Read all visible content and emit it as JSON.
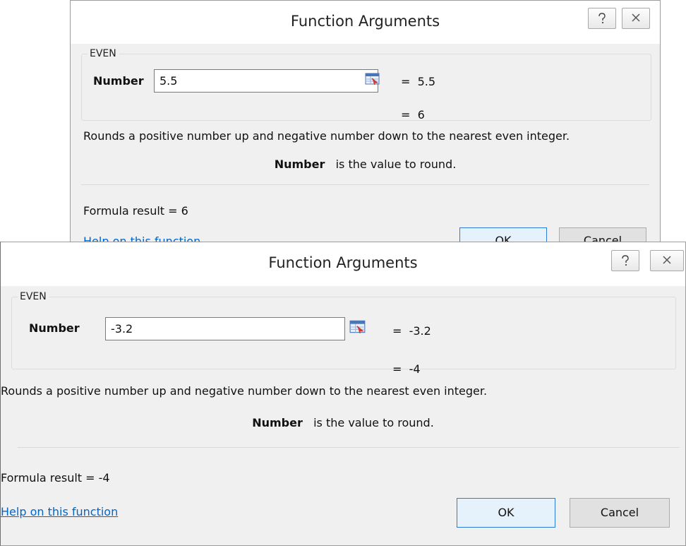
{
  "dialogs": [
    {
      "title": "Function Arguments",
      "function_name": "EVEN",
      "arg_label": "Number",
      "arg_value": "5.5",
      "arg_result": "=  5.5",
      "function_result": "=  6",
      "description": "Rounds a positive number up and negative number down to the nearest even integer.",
      "arg_help_name": "Number",
      "arg_help_text": "is the value to round.",
      "formula_result": "Formula result =  6",
      "help_link": "Help on this function",
      "ok_label": "OK",
      "cancel_label": "Cancel"
    },
    {
      "title": "Function Arguments",
      "function_name": "EVEN",
      "arg_label": "Number",
      "arg_value": "-3.2",
      "arg_result": "=  -3.2",
      "function_result": "=  -4",
      "description": "Rounds a positive number up and negative number down to the nearest even integer.",
      "arg_help_name": "Number",
      "arg_help_text": "is the value to round.",
      "formula_result": "Formula result =  -4",
      "help_link": "Help on this function",
      "ok_label": "OK",
      "cancel_label": "Cancel"
    }
  ],
  "icons": {
    "help": "question-mark-icon",
    "close": "close-icon",
    "collapse": "collapse-dialog-icon"
  },
  "colors": {
    "link": "#0066cc",
    "default_button_border": "#2e7bd6",
    "dialog_body": "#f0f0f0"
  }
}
